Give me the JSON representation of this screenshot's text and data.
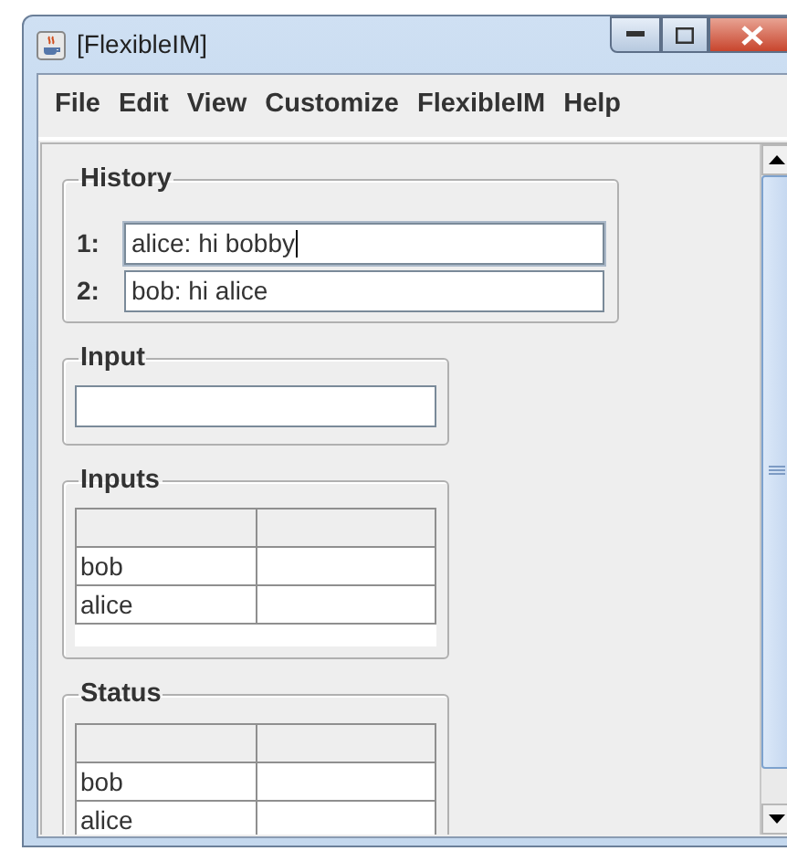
{
  "window": {
    "title": "[FlexibleIM]"
  },
  "menu": [
    "File",
    "Edit",
    "View",
    "Customize",
    "FlexibleIM",
    "Help"
  ],
  "history": {
    "title": "History",
    "entries": [
      {
        "index": "1:",
        "text": "alice: hi bobby",
        "focused": true
      },
      {
        "index": "2:",
        "text": "bob: hi alice",
        "focused": false
      }
    ]
  },
  "input": {
    "title": "Input"
  },
  "inputs": {
    "title": "Inputs",
    "rows": [
      {
        "name": "bob"
      },
      {
        "name": "alice"
      }
    ]
  },
  "status": {
    "title": "Status",
    "rows": [
      {
        "name": "bob"
      },
      {
        "name": "alice"
      }
    ]
  }
}
